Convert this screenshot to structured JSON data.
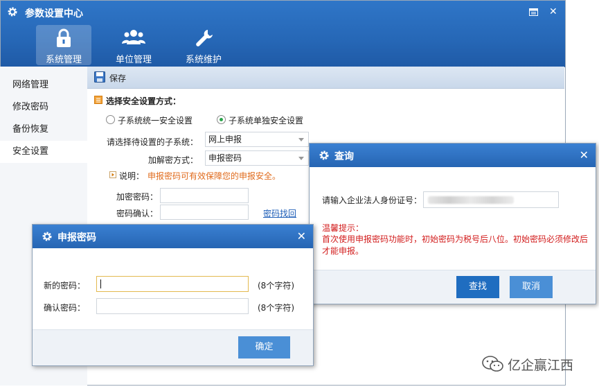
{
  "window": {
    "title": "参数设置中心"
  },
  "nav_tabs": [
    {
      "label": "系统管理",
      "icon": "lock-icon",
      "active": true
    },
    {
      "label": "单位管理",
      "icon": "users-icon",
      "active": false
    },
    {
      "label": "系统维护",
      "icon": "wrench-icon",
      "active": false
    }
  ],
  "sidebar": {
    "items": [
      {
        "label": "网络管理"
      },
      {
        "label": "修改密码"
      },
      {
        "label": "备份恢复"
      },
      {
        "label": "安全设置",
        "active": true
      }
    ]
  },
  "toolbar": {
    "save_label": "保存"
  },
  "security": {
    "heading": "选择安全设置方式：",
    "radio_unified": "子系统统一安全设置",
    "radio_individual": "子系统单独安全设置",
    "selected": "individual",
    "subsystem_label": "请选择待设置的子系统：",
    "subsystem_value": "网上申报",
    "encrypt_label": "加解密方式：",
    "encrypt_value": "申报密码",
    "note_label": "说明：",
    "note_text": "申报密码可有效保障您的申报安全。",
    "password_label": "加密密码：",
    "confirm_label": "密码确认：",
    "recover_link": "密码找回"
  },
  "query_dialog": {
    "title": "查询",
    "id_label": "请输入企业法人身份证号：",
    "tip_title": "温馨提示：",
    "tip_text": "首次使用申报密码功能时，初始密码为税号后八位。初始密码必须修改后才能申报。",
    "find_button": "查找",
    "cancel_button": "取消"
  },
  "password_dialog": {
    "title": "申报密码",
    "new_label": "新的密码：",
    "confirm_label": "确认密码：",
    "hint_new": "(8个字符)",
    "hint_confirm": "(8个字符)",
    "ok_button": "确定"
  },
  "watermark": {
    "text": "亿企赢江西"
  },
  "colors": {
    "header_blue": "#2667b6",
    "button_blue": "#1f6dc0",
    "button_light": "#4a8fd6",
    "tip_red": "#d21c1c",
    "note_orange": "#e06a1b",
    "radio_green": "#2aa44a"
  }
}
